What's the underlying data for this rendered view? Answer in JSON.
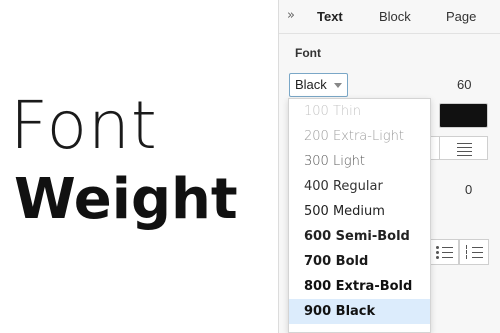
{
  "preview": {
    "line1": "Font",
    "line2": "Weight"
  },
  "panel": {
    "collapse_icon": "»",
    "tabs": [
      {
        "label": "Text",
        "active": true
      },
      {
        "label": "Block",
        "active": false
      },
      {
        "label": "Page",
        "active": false
      }
    ],
    "section_label": "Font",
    "weight_select_value": "Black",
    "font_size": "60",
    "color": "#111111",
    "letter_spacing": "0"
  },
  "menu": {
    "items": [
      {
        "label": "100 Thin",
        "weight": 100,
        "color": "#c4c4c4"
      },
      {
        "label": "200 Extra-Light",
        "weight": 200,
        "color": "#9a9a9a"
      },
      {
        "label": "300 Light",
        "weight": 300,
        "color": "#555555"
      },
      {
        "label": "400 Regular",
        "weight": 400,
        "color": "#333333"
      },
      {
        "label": "500 Medium",
        "weight": 500,
        "color": "#222222"
      },
      {
        "label": "600 Semi-Bold",
        "weight": 600,
        "color": "#222222"
      },
      {
        "label": "700 Bold",
        "weight": 700,
        "color": "#1a1a1a"
      },
      {
        "label": "800 Extra-Bold",
        "weight": 800,
        "color": "#111111"
      },
      {
        "label": "900 Black",
        "weight": 900,
        "color": "#111111",
        "selected": true
      }
    ],
    "selected_bg": "#dcecfc"
  }
}
